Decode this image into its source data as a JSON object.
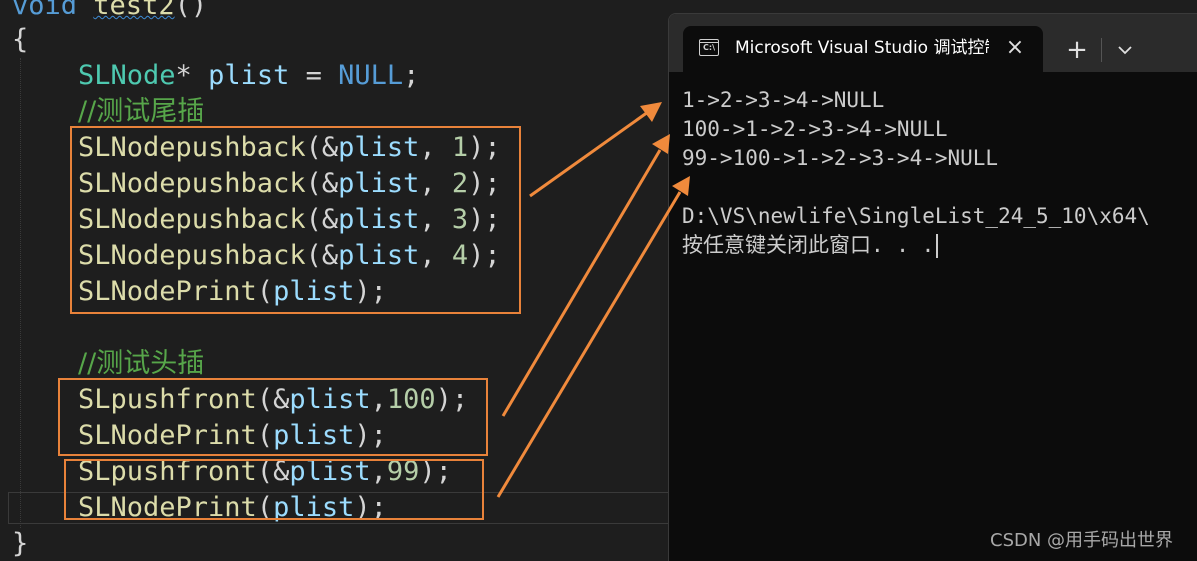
{
  "editor": {
    "colors": {
      "background": "#1e1e1e",
      "highlight_box": "#e8823a",
      "comment": "#57a64a",
      "keyword": "#569cd6",
      "function": "#dcdcaa",
      "type": "#4ec9b0",
      "variable": "#9cdcfe",
      "number": "#b5cea8"
    },
    "lines": {
      "sig_kw": "void",
      "sig_name": "test2",
      "sig_paren": "()",
      "open_brace": "{",
      "decl_type": "SLNode",
      "decl_star": "* ",
      "decl_var": "plist",
      "decl_eq": " = ",
      "decl_null": "NULL",
      "decl_semi": ";",
      "comment_tail": "//测试尾插",
      "tail_fn": "SLNodepushback",
      "tail_values": [
        "1",
        "2",
        "3",
        "4"
      ],
      "print_fn": "SLNodePrint",
      "comment_head": "//测试头插",
      "front_fn": "SLpushfront",
      "front_value_1": "100",
      "front_value_2": "99",
      "var": "plist",
      "close_brace": "}"
    }
  },
  "console": {
    "tab_title": "Microsoft Visual Studio 调试控制台",
    "tab_icon": "console-icon",
    "close_icon": "×",
    "new_tab_icon": "+",
    "dropdown_icon": "chevron-down-icon",
    "output": [
      "1->2->3->4->NULL",
      "100->1->2->3->4->NULL",
      "99->100->1->2->3->4->NULL",
      "",
      "D:\\VS\\newlife\\SingleList_24_5_10\\x64\\",
      "按任意键关闭此窗口. . ."
    ]
  },
  "watermark": "CSDN @用手码出世界",
  "annotation_color": "#f08a3c"
}
